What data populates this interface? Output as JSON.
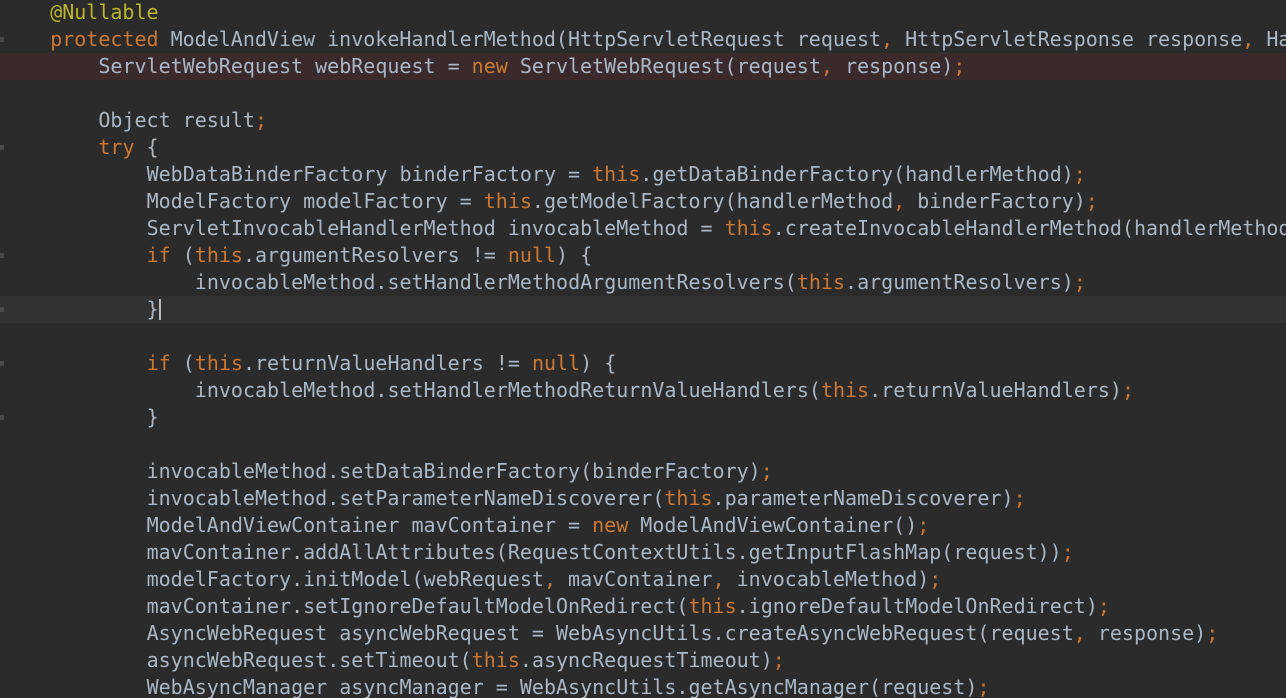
{
  "editor": {
    "colors": {
      "background": "#2b2b2b",
      "default_text": "#a9b7c6",
      "keyword": "#cc7832",
      "annotation": "#bbb529",
      "error_line": "#3b2a2c",
      "current_line": "#323232"
    },
    "lines": [
      {
        "indent": 1,
        "tokens": [
          {
            "t": "@Nullable",
            "c": "a"
          }
        ]
      },
      {
        "indent": 1,
        "tokens": [
          {
            "t": "protected",
            "c": "k"
          },
          {
            "t": " ModelAndView invokeHandlerMethod(HttpServletRequest request",
            "c": ""
          },
          {
            "t": ",",
            "c": "k"
          },
          {
            "t": " HttpServletResponse response",
            "c": ""
          },
          {
            "t": ",",
            "c": "k"
          },
          {
            "t": " Ha",
            "c": ""
          }
        ]
      },
      {
        "indent": 2,
        "tokens": [
          {
            "t": "ServletWebRequest webRequest = ",
            "c": ""
          },
          {
            "t": "new",
            "c": "k"
          },
          {
            "t": " ServletWebRequest(request",
            "c": ""
          },
          {
            "t": ",",
            "c": "k"
          },
          {
            "t": " response)",
            "c": ""
          },
          {
            "t": ";",
            "c": "k"
          }
        ]
      },
      {
        "indent": 0,
        "tokens": []
      },
      {
        "indent": 2,
        "tokens": [
          {
            "t": "Object result",
            "c": ""
          },
          {
            "t": ";",
            "c": "k"
          }
        ]
      },
      {
        "indent": 2,
        "tokens": [
          {
            "t": "try",
            "c": "k"
          },
          {
            "t": " {",
            "c": ""
          }
        ]
      },
      {
        "indent": 3,
        "tokens": [
          {
            "t": "WebDataBinderFactory binderFactory = ",
            "c": ""
          },
          {
            "t": "this",
            "c": "k"
          },
          {
            "t": ".getDataBinderFactory(handlerMethod)",
            "c": ""
          },
          {
            "t": ";",
            "c": "k"
          }
        ]
      },
      {
        "indent": 3,
        "tokens": [
          {
            "t": "ModelFactory modelFactory = ",
            "c": ""
          },
          {
            "t": "this",
            "c": "k"
          },
          {
            "t": ".getModelFactory(handlerMethod",
            "c": ""
          },
          {
            "t": ",",
            "c": "k"
          },
          {
            "t": " binderFactory)",
            "c": ""
          },
          {
            "t": ";",
            "c": "k"
          }
        ]
      },
      {
        "indent": 3,
        "tokens": [
          {
            "t": "ServletInvocableHandlerMethod invocableMethod = ",
            "c": ""
          },
          {
            "t": "this",
            "c": "k"
          },
          {
            "t": ".createInvocableHandlerMethod(handlerMethod",
            "c": ""
          }
        ]
      },
      {
        "indent": 3,
        "tokens": [
          {
            "t": "if",
            "c": "k"
          },
          {
            "t": " (",
            "c": ""
          },
          {
            "t": "this",
            "c": "k"
          },
          {
            "t": ".argumentResolvers != ",
            "c": ""
          },
          {
            "t": "null",
            "c": "k"
          },
          {
            "t": ") {",
            "c": ""
          }
        ]
      },
      {
        "indent": 4,
        "tokens": [
          {
            "t": "invocableMethod.setHandlerMethodArgumentResolvers(",
            "c": ""
          },
          {
            "t": "this",
            "c": "k"
          },
          {
            "t": ".argumentResolvers)",
            "c": ""
          },
          {
            "t": ";",
            "c": "k"
          }
        ]
      },
      {
        "indent": 3,
        "tokens": [
          {
            "t": "}",
            "c": ""
          }
        ]
      },
      {
        "indent": 0,
        "tokens": []
      },
      {
        "indent": 3,
        "tokens": [
          {
            "t": "if",
            "c": "k"
          },
          {
            "t": " (",
            "c": ""
          },
          {
            "t": "this",
            "c": "k"
          },
          {
            "t": ".returnValueHandlers != ",
            "c": ""
          },
          {
            "t": "null",
            "c": "k"
          },
          {
            "t": ") {",
            "c": ""
          }
        ]
      },
      {
        "indent": 4,
        "tokens": [
          {
            "t": "invocableMethod.setHandlerMethodReturnValueHandlers(",
            "c": ""
          },
          {
            "t": "this",
            "c": "k"
          },
          {
            "t": ".returnValueHandlers)",
            "c": ""
          },
          {
            "t": ";",
            "c": "k"
          }
        ]
      },
      {
        "indent": 3,
        "tokens": [
          {
            "t": "}",
            "c": ""
          }
        ]
      },
      {
        "indent": 0,
        "tokens": []
      },
      {
        "indent": 3,
        "tokens": [
          {
            "t": "invocableMethod.setDataBinderFactory(binderFactory)",
            "c": ""
          },
          {
            "t": ";",
            "c": "k"
          }
        ]
      },
      {
        "indent": 3,
        "tokens": [
          {
            "t": "invocableMethod.setParameterNameDiscoverer(",
            "c": ""
          },
          {
            "t": "this",
            "c": "k"
          },
          {
            "t": ".parameterNameDiscoverer)",
            "c": ""
          },
          {
            "t": ";",
            "c": "k"
          }
        ]
      },
      {
        "indent": 3,
        "tokens": [
          {
            "t": "ModelAndViewContainer mavContainer = ",
            "c": ""
          },
          {
            "t": "new",
            "c": "k"
          },
          {
            "t": " ModelAndViewContainer()",
            "c": ""
          },
          {
            "t": ";",
            "c": "k"
          }
        ]
      },
      {
        "indent": 3,
        "tokens": [
          {
            "t": "mavContainer.addAllAttributes(RequestContextUtils.getInputFlashMap(request))",
            "c": ""
          },
          {
            "t": ";",
            "c": "k"
          }
        ]
      },
      {
        "indent": 3,
        "tokens": [
          {
            "t": "modelFactory.initModel(webRequest",
            "c": ""
          },
          {
            "t": ",",
            "c": "k"
          },
          {
            "t": " mavContainer",
            "c": ""
          },
          {
            "t": ",",
            "c": "k"
          },
          {
            "t": " invocableMethod)",
            "c": ""
          },
          {
            "t": ";",
            "c": "k"
          }
        ]
      },
      {
        "indent": 3,
        "tokens": [
          {
            "t": "mavContainer.setIgnoreDefaultModelOnRedirect(",
            "c": ""
          },
          {
            "t": "this",
            "c": "k"
          },
          {
            "t": ".ignoreDefaultModelOnRedirect)",
            "c": ""
          },
          {
            "t": ";",
            "c": "k"
          }
        ]
      },
      {
        "indent": 3,
        "tokens": [
          {
            "t": "AsyncWebRequest asyncWebRequest = WebAsyncUtils.createAsyncWebRequest(request",
            "c": ""
          },
          {
            "t": ",",
            "c": "k"
          },
          {
            "t": " response)",
            "c": ""
          },
          {
            "t": ";",
            "c": "k"
          }
        ]
      },
      {
        "indent": 3,
        "tokens": [
          {
            "t": "asyncWebRequest.setTimeout(",
            "c": ""
          },
          {
            "t": "this",
            "c": "k"
          },
          {
            "t": ".asyncRequestTimeout)",
            "c": ""
          },
          {
            "t": ";",
            "c": "k"
          }
        ]
      },
      {
        "indent": 3,
        "tokens": [
          {
            "t": "WebAsyncManager asyncManager = WebAsyncUtils.getAsyncManager(request)",
            "c": ""
          },
          {
            "t": ";",
            "c": "k"
          }
        ]
      }
    ],
    "error_line_index": 2,
    "current_line_index": 11,
    "gutter_marker_line_indices": [
      1,
      5,
      9,
      11,
      13,
      15
    ]
  }
}
